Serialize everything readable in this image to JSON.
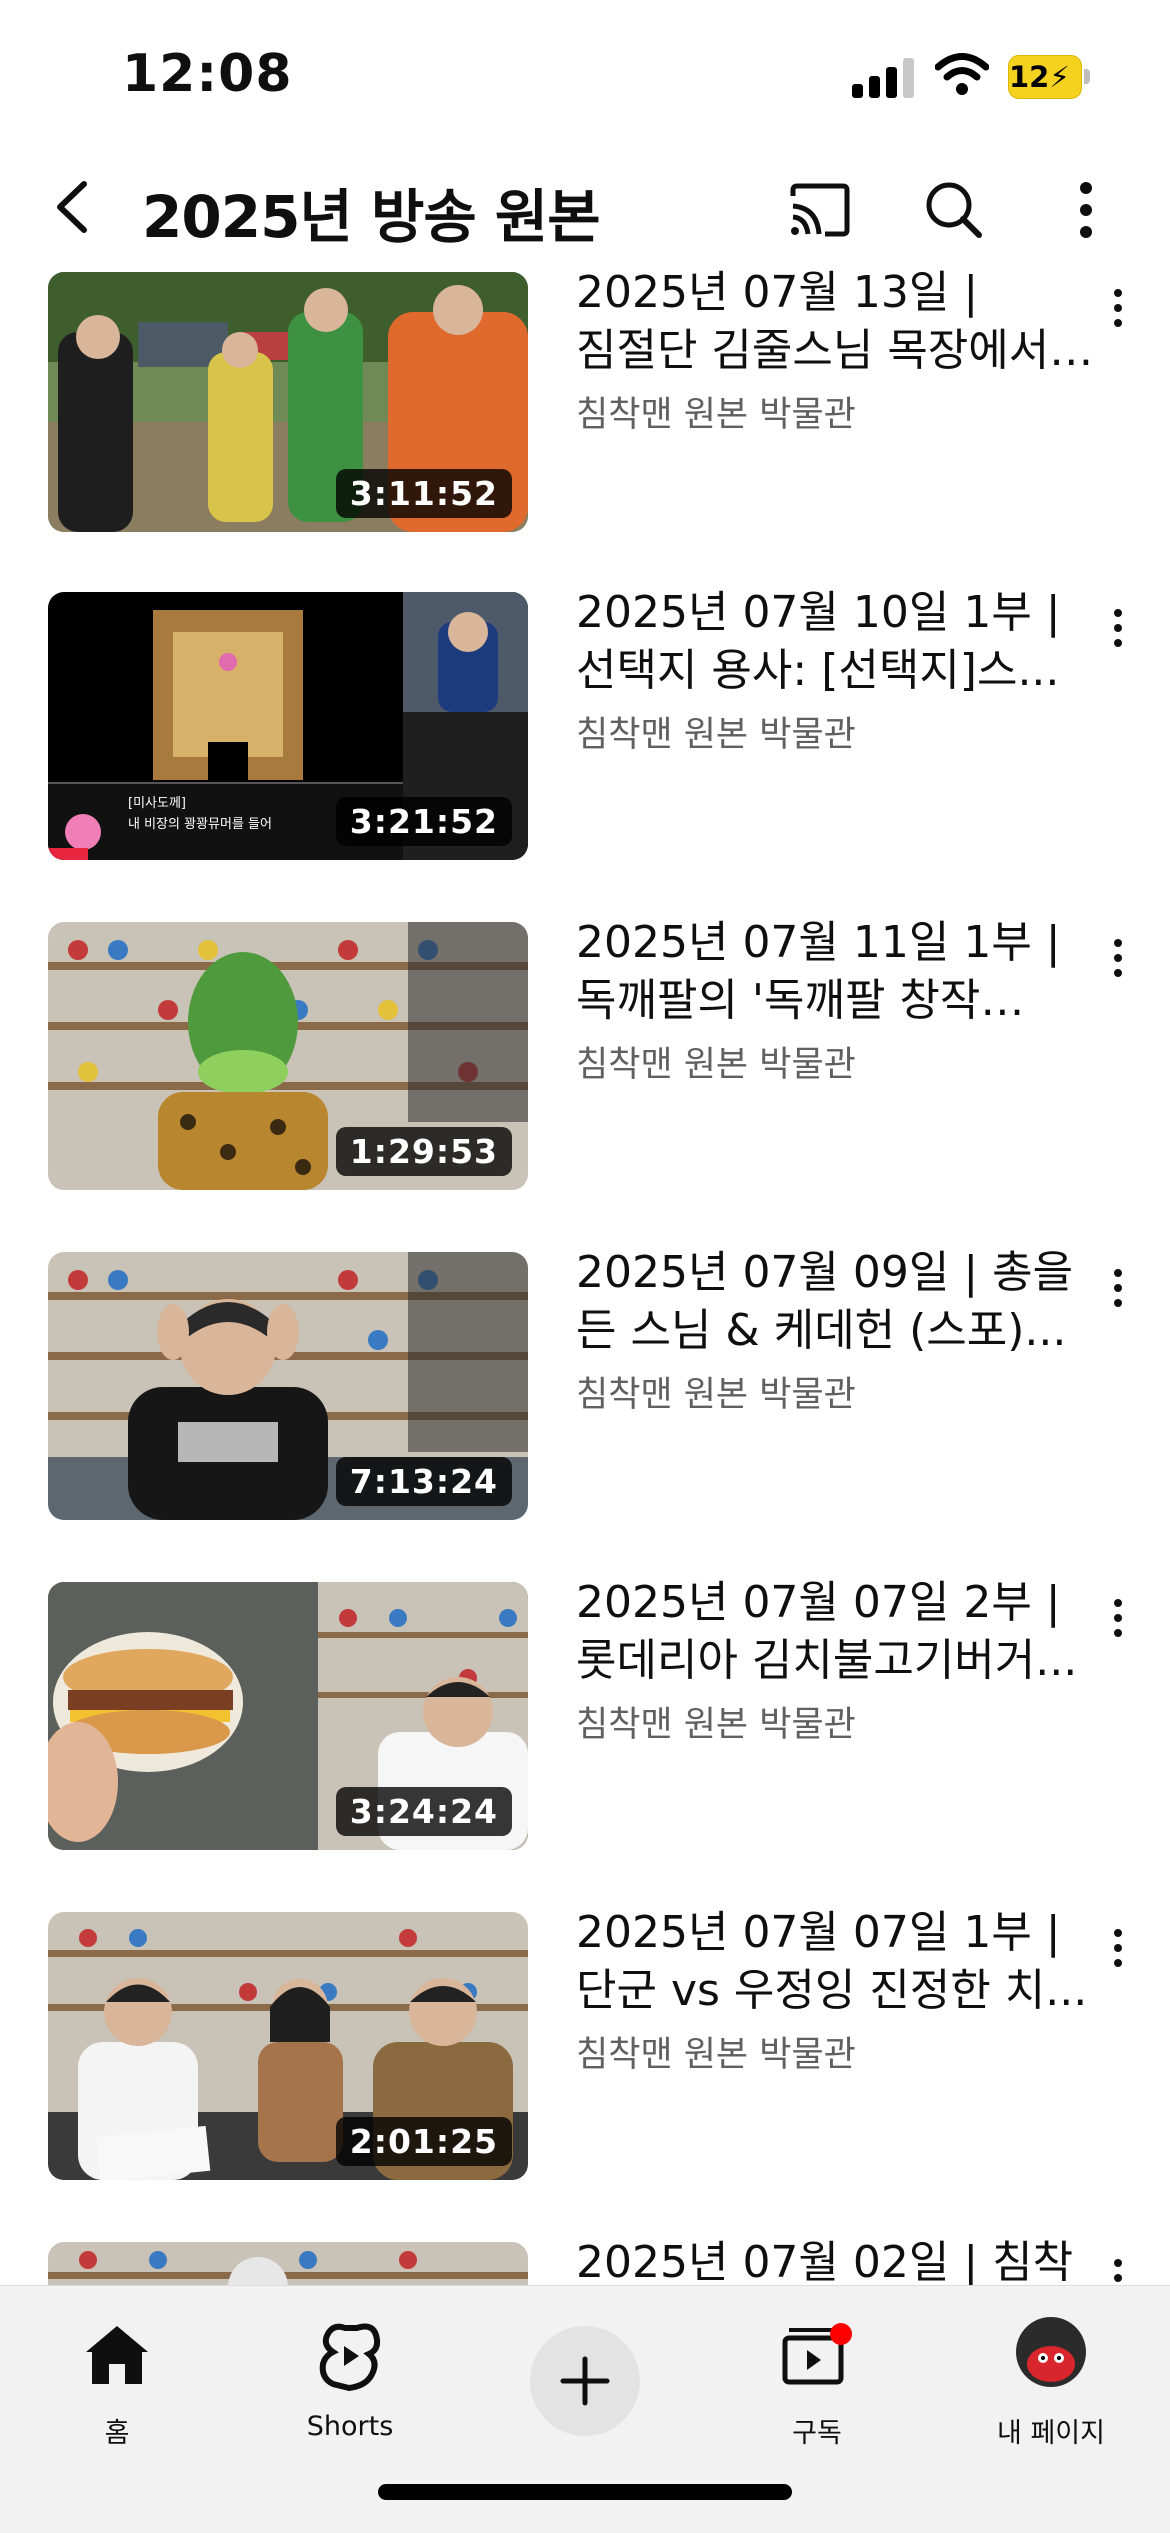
{
  "status": {
    "time": "12:08",
    "battery": "12"
  },
  "header": {
    "title": "2025년 방송 원본"
  },
  "videos": [
    {
      "title": "2025년 07월 13일 | 짐절단 김줄스님 목장에서 동...",
      "channel": "침착맨 원본 박물관",
      "duration": "3:11:52"
    },
    {
      "title": "2025년 07월 10일 1부 | 선택지 용사: [선택지]스...",
      "channel": "침착맨 원본 박물관",
      "duration": "3:21:52"
    },
    {
      "title": "2025년 07월 11일 1부 | 독깨팔의 '독깨팔 창작 공모전'",
      "channel": "침착맨 원본 박물관",
      "duration": "1:29:53"
    },
    {
      "title": "2025년 07월 09일 | 총을 든 스님 & 케데헌 (스포)...",
      "channel": "침착맨 원본 박물관",
      "duration": "7:13:24"
    },
    {
      "title": "2025년 07월 07일 2부 | 롯데리아 김치불고기버거...",
      "channel": "침착맨 원본 박물관",
      "duration": "3:24:24"
    },
    {
      "title": "2025년 07월 07일 1부 | 단군 vs 우정잉 진정한 치...",
      "channel": "침착맨 원본 박물관",
      "duration": "2:01:25"
    },
    {
      "title": "2025년 07월 02일 | 침착",
      "channel": "",
      "duration": ""
    }
  ],
  "thumb_captions": {
    "game_speaker": "[미사도께]",
    "game_line": "내 비장의 꽝꽝뮤머를 들어"
  },
  "nav": {
    "home": "홈",
    "shorts": "Shorts",
    "subscriptions": "구독",
    "me": "내 페이지"
  },
  "colors": {
    "accent": "#ff0000",
    "battery": "#f4d21f",
    "secondary_text": "#606060"
  }
}
